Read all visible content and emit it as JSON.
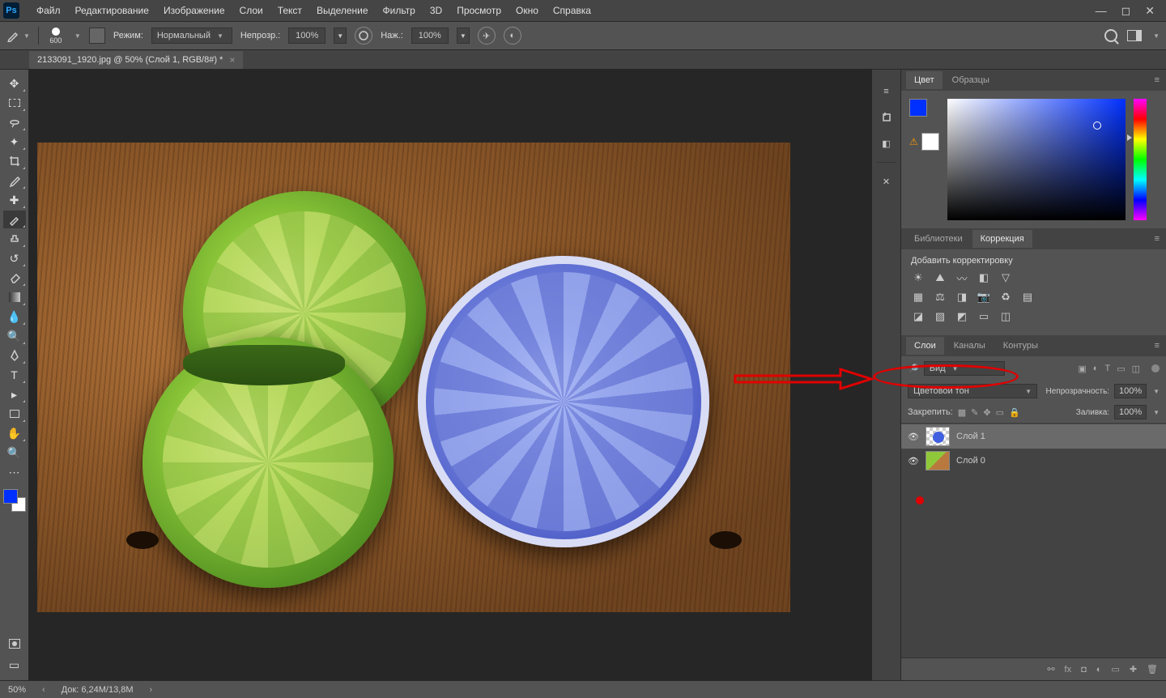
{
  "menubar": {
    "items": [
      "Файл",
      "Редактирование",
      "Изображение",
      "Слои",
      "Текст",
      "Выделение",
      "Фильтр",
      "3D",
      "Просмотр",
      "Окно",
      "Справка"
    ]
  },
  "optbar": {
    "brush_size": "600",
    "mode_label": "Режим:",
    "mode_value": "Нормальный",
    "opacity_label": "Непрозр.:",
    "opacity_value": "100%",
    "flow_label": "Наж.:",
    "flow_value": "100%"
  },
  "doc_tab": {
    "title": "2133091_1920.jpg @ 50% (Слой 1, RGB/8#) *"
  },
  "panels": {
    "color_tab": "Цвет",
    "swatches_tab": "Образцы",
    "lib_tab": "Библиотеки",
    "adj_tab": "Коррекция",
    "adj_header": "Добавить корректировку",
    "layers_tab": "Слои",
    "channels_tab": "Каналы",
    "paths_tab": "Контуры",
    "filter_kind": "Вид",
    "blend_mode": "Цветовой тон",
    "opacity_label": "Непрозрачность:",
    "opacity_value": "100%",
    "lock_label": "Закрепить:",
    "fill_label": "Заливка:",
    "fill_value": "100%",
    "layers": [
      {
        "name": "Слой 1"
      },
      {
        "name": "Слой 0"
      }
    ]
  },
  "statusbar": {
    "zoom": "50%",
    "doc_info": "Док: 6,24M/13,8M"
  }
}
